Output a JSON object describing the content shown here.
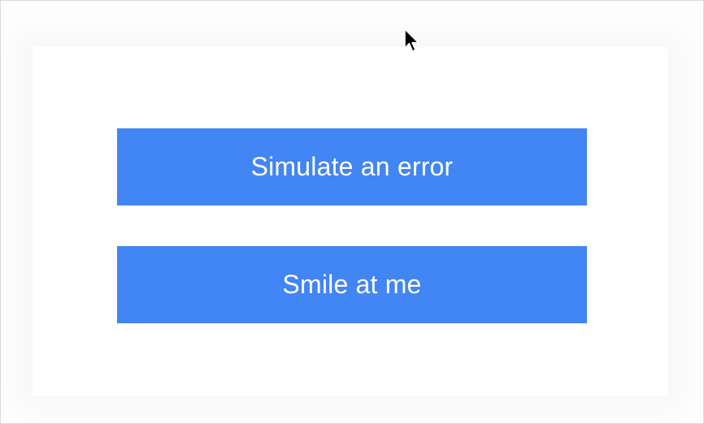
{
  "buttons": {
    "simulate_error_label": "Simulate an error",
    "smile_label": "Smile at me",
    "background_color": "#4285f4",
    "text_color": "#ffffff"
  },
  "cursor": {
    "icon": "arrow-cursor-icon"
  }
}
